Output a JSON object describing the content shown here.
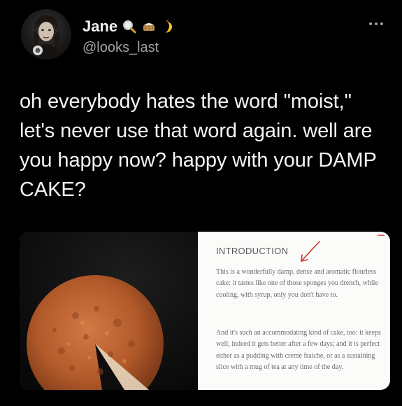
{
  "author": {
    "display_name": "Jane",
    "handle": "@looks_last",
    "emojis": [
      "magnifying-glass-emoji",
      "cake-basket-emoji",
      "banana-emoji"
    ]
  },
  "tweet": {
    "text": "oh everybody hates the word \"moist,\" let's never use that word again. well are you happy now? happy with your DAMP CAKE?"
  },
  "media": {
    "heading": "INTRODUCTION",
    "paragraph_1": "This is a wonderfully damp, dense and aromatic flourless cake: it tastes like one of those sponges you drench, while cooling, with syrup, only you don't have to.",
    "paragraph_2": "And it's such an accommodating kind of cake, too: it keeps well, indeed it gets better after a few days; and it is perfect either as a pudding with creme fraiche, or as a sustaining slice with a mug of tea at any time of the day."
  },
  "colors": {
    "background": "#000000",
    "text": "#f4f4f4",
    "muted": "#a0a4a8",
    "annotation_red": "#c8362c"
  }
}
